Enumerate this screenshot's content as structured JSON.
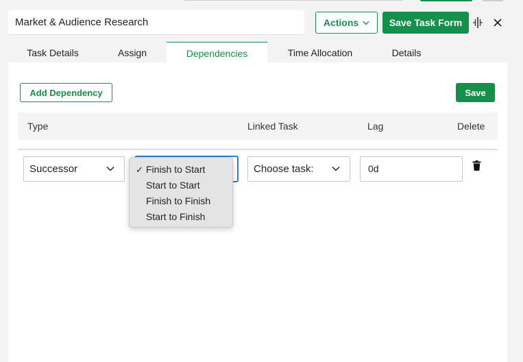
{
  "task": {
    "title": "Market & Audience Research"
  },
  "toolbar": {
    "actions_label": "Actions",
    "save_form_label": "Save Task Form"
  },
  "tabs": [
    {
      "label": "Task Details",
      "active": false
    },
    {
      "label": "Assign",
      "active": false
    },
    {
      "label": "Dependencies",
      "active": true
    },
    {
      "label": "Time Allocation",
      "active": false
    },
    {
      "label": "Details",
      "active": false
    }
  ],
  "dependencies": {
    "add_label": "Add Dependency",
    "save_label": "Save",
    "columns": [
      "Type",
      "Linked Task",
      "Lag",
      "Delete"
    ],
    "rows": [
      {
        "type": "Successor",
        "relation": "Finish to Start",
        "linked_task": "Choose task:",
        "lag": "0d"
      }
    ],
    "relation_options": [
      {
        "label": "Finish to Start",
        "selected": true
      },
      {
        "label": "Start to Start",
        "selected": false
      },
      {
        "label": "Finish to Finish",
        "selected": false
      },
      {
        "label": "Start to Finish",
        "selected": false
      }
    ],
    "check_mark": "✓"
  },
  "colors": {
    "accent": "#15904a",
    "focus": "#2c7fc6",
    "header_bg": "#f4f4f4"
  },
  "icons": {
    "actions_chevron": "chevron-down-icon",
    "split": "split-view-icon",
    "close": "close-icon",
    "delete": "trash-icon"
  }
}
